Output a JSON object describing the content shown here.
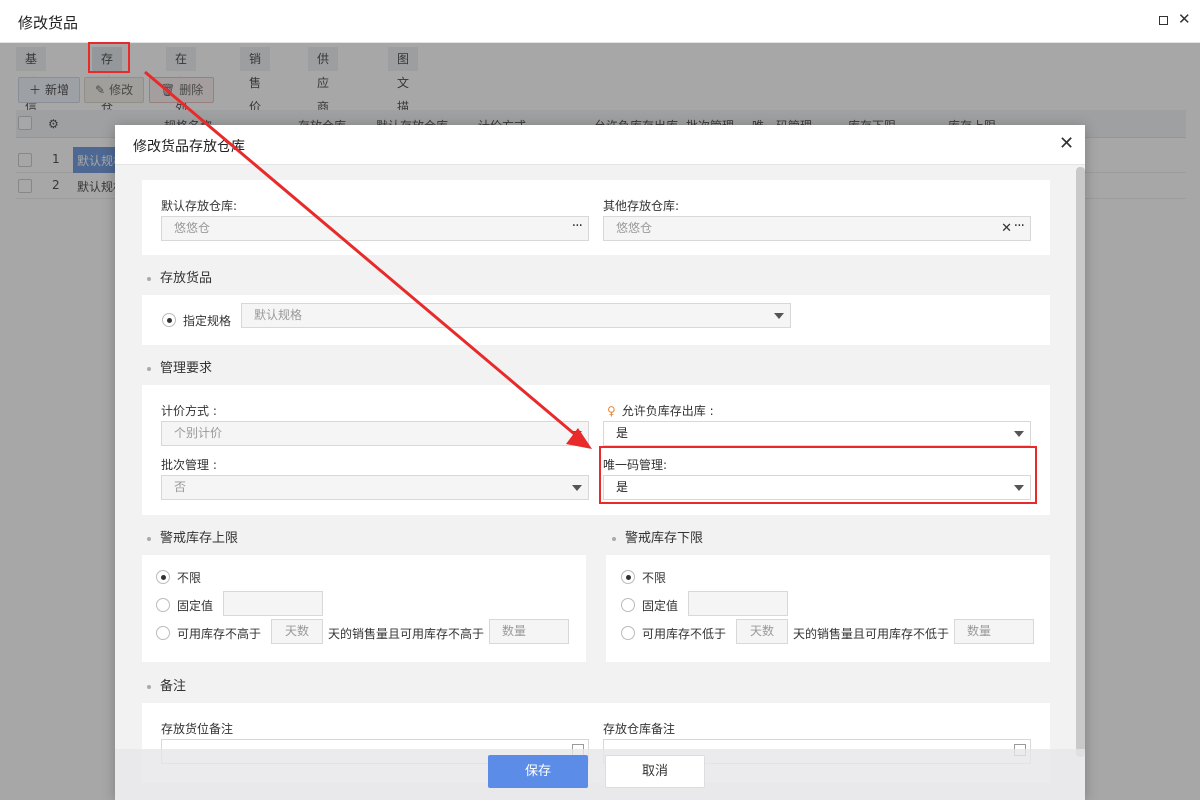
{
  "outer_window": {
    "title": "修改货品",
    "tabs": [
      "基础信息",
      "存放仓库",
      "在售列表",
      "销售价格",
      "供应商报价",
      "图文描述"
    ],
    "toolbar": {
      "add_label": "新增",
      "edit_label": "修改",
      "delete_label": "删除"
    },
    "grid_headers": [
      "规格名称",
      "存放仓库",
      "默认存放仓库",
      "计价方式",
      "允许负库存出库",
      "批次管理",
      "唯一码管理",
      "库存下限",
      "库存上限"
    ],
    "rows": [
      {
        "num": "1",
        "name": "默认规格"
      },
      {
        "num": "2",
        "name": "默认规格"
      }
    ]
  },
  "dialog": {
    "title": "修改货品存放仓库",
    "default_warehouse": {
      "label": "默认存放仓库:",
      "value": "悠悠仓"
    },
    "other_warehouse": {
      "label": "其他存放仓库:",
      "value": "悠悠仓"
    },
    "section_goods": "存放货品",
    "specify_spec": {
      "label": "指定规格",
      "value": "默认规格"
    },
    "section_manage": "管理要求",
    "pricing": {
      "label": "计价方式 :",
      "value": "个别计价"
    },
    "allow_negative": {
      "label": "允许负库存出库 :",
      "value": "是"
    },
    "batch": {
      "label": "批次管理 :",
      "value": "否"
    },
    "unique_code": {
      "label": "唯一码管理:",
      "value": "是"
    },
    "upper_limit": {
      "title": "警戒库存上限",
      "opt_unlimited": "不限",
      "opt_fixed": "固定值",
      "opt_available_prefix": "可用库存不高于",
      "days_placeholder": "天数",
      "mid_text": "天的销售量且可用库存不高于",
      "qty_placeholder": "数量"
    },
    "lower_limit": {
      "title": "警戒库存下限",
      "opt_unlimited": "不限",
      "opt_fixed": "固定值",
      "opt_available_prefix": "可用库存不低于",
      "days_placeholder": "天数",
      "mid_text": "天的销售量且可用库存不低于",
      "qty_placeholder": "数量"
    },
    "section_remark": "备注",
    "location_remark_label": "存放货位备注",
    "warehouse_remark_label": "存放仓库备注",
    "save_label": "保存",
    "cancel_label": "取消"
  },
  "colors": {
    "primary": "#5b8de8",
    "highlight": "#e82a2a",
    "selected_cell": "#5b8dd9"
  }
}
